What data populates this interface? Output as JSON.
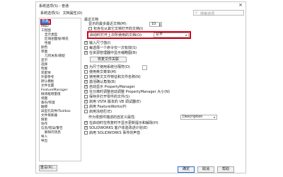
{
  "window": {
    "title": "系统选项(S) - 普通",
    "close_glyph": "×"
  },
  "tabs": [
    "系统选项(S)",
    "文档属性(D)"
  ],
  "search": {
    "placeholder": "搜索选项"
  },
  "tree": [
    {
      "label": "普通",
      "level": 0,
      "selected": true
    },
    {
      "label": "MBD",
      "level": 0
    },
    {
      "label": "工程图",
      "level": 0
    },
    {
      "label": "显示类型",
      "level": 1
    },
    {
      "label": "区域剖面线/填充",
      "level": 1
    },
    {
      "label": "性能",
      "level": 1
    },
    {
      "label": "颜色",
      "level": 0
    },
    {
      "label": "草图",
      "level": 0
    },
    {
      "label": "几何关系/捕捉",
      "level": 1
    },
    {
      "label": "显示",
      "level": 0
    },
    {
      "label": "选择",
      "level": 0
    },
    {
      "label": "性能",
      "level": 0
    },
    {
      "label": "装配体",
      "level": 0
    },
    {
      "label": "外部参考",
      "level": 0
    },
    {
      "label": "默认模板",
      "level": 0
    },
    {
      "label": "文件位置",
      "level": 0
    },
    {
      "label": "FeatureManager",
      "level": 0
    },
    {
      "label": "微调框增量值",
      "level": 0
    },
    {
      "label": "视图",
      "level": 0
    },
    {
      "label": "备份/恢复",
      "level": 0
    },
    {
      "label": "触摸",
      "level": 0
    },
    {
      "label": "异型孔向导/Toolbox",
      "level": 0
    },
    {
      "label": "文件探索器",
      "level": 0
    },
    {
      "label": "搜索",
      "level": 0
    },
    {
      "label": "协作",
      "level": 0
    },
    {
      "label": "信息/错误/警告",
      "level": 0
    },
    {
      "label": "解除的消息",
      "level": 1
    },
    {
      "label": "导入",
      "level": 0
    },
    {
      "label": "导出",
      "level": 0
    }
  ],
  "reset_button": "重设(R)...",
  "general": {
    "recent_docs_heading": "最近文档",
    "max_recent_label": "显示的最多最近文档(M):",
    "max_recent_value": "10",
    "include_recent_label": "包含在从其它文档打开的文档(I)",
    "startup_open_label": "启动时打开上次所使用的文档(O):",
    "startup_open_value": "从不",
    "input_dimension_label": "输入尺寸值(I)",
    "single_command_label": "每选择一个命令仅一次有效(S)",
    "resource_monitor_label": "在资源管理器中显示缩略图(B)",
    "restore_assoc_button": "恢复文件关联",
    "use_system_separator_label": "为尺寸使用系统分隔符(D)",
    "use_english_menu_label": "使用英文菜单(M)",
    "english_feature_label": "使用英文文件特征和文件名称(N)",
    "confirm_notification_label": "激活确认角落(B)",
    "auto_show_pm_label": "自动显示 PropertyManager",
    "auto_size_pm_label": "在分离时调整自动调整 PropertyManager 大小(N)",
    "add_rebuild_label": "保存并打开零件的文件(S)",
    "enable_vsta_label": "启用 VSTA 版本的 VB 调试器(E)",
    "enable_featureworks_label": "启用 FeatureWorks(P)",
    "enable_freeze_bar_label": "启用冻结栏(E)",
    "custom_property_label": "作为零部件描述的自定义属性:",
    "custom_property_value": "Description",
    "check_updates_label": "在启动时在恢复时不显示更新提示和解除(H)",
    "customer_improvement_label": "SOLIDWORKS 客户体验改进计划(E)",
    "sounds_label": "启用 SOLIDWORKS 事件的声音"
  },
  "checked": {
    "include_recent": false,
    "input_dimension": true,
    "single_command": false,
    "resource_monitor": true,
    "use_system_separator": true,
    "use_english_menu": false,
    "english_feature": false,
    "confirm_notification": true,
    "auto_show_pm": true,
    "auto_size_pm": true,
    "add_rebuild": false,
    "enable_vsta": true,
    "enable_featureworks": false,
    "enable_freeze_bar": false,
    "check_updates": true,
    "customer_improvement": true,
    "sounds": false
  },
  "footer": {
    "ok": "确定",
    "cancel": "取消",
    "help": "帮助"
  },
  "colors": {
    "accent": "#2e6fd1",
    "highlight": "#d0021b"
  }
}
